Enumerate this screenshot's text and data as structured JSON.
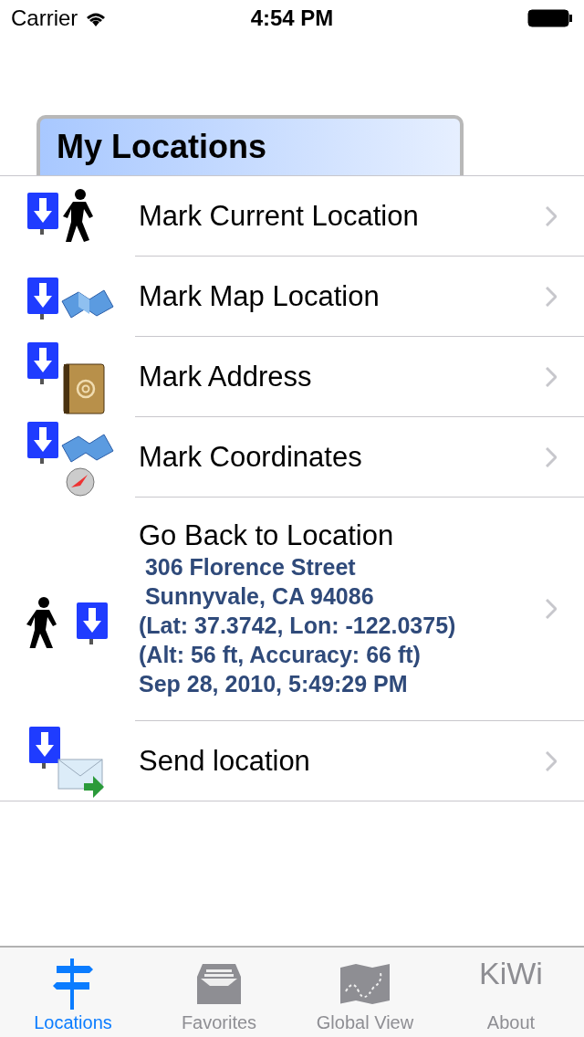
{
  "status_bar": {
    "carrier": "Carrier",
    "time": "4:54 PM"
  },
  "header": {
    "title": "My Locations"
  },
  "rows": [
    {
      "kind": "walk",
      "label": "Mark Current Location"
    },
    {
      "kind": "map",
      "label": "Mark Map Location"
    },
    {
      "kind": "address",
      "label": "Mark Address"
    },
    {
      "kind": "coords",
      "label": "Mark Coordinates"
    },
    {
      "kind": "return",
      "label": "Go Back to Location",
      "details": [
        " 306 Florence Street",
        " Sunnyvale, CA 94086",
        "(Lat: 37.3742, Lon: -122.0375)",
        "(Alt: 56 ft, Accuracy: 66 ft)",
        "Sep 28, 2010, 5:49:29 PM"
      ]
    },
    {
      "kind": "mail",
      "label": "Send location"
    }
  ],
  "tab_bar": [
    {
      "kind": "signpost",
      "label": "Locations",
      "selected": true
    },
    {
      "kind": "tray",
      "label": "Favorites",
      "selected": false
    },
    {
      "kind": "map",
      "label": "Global View",
      "selected": false
    },
    {
      "kind": "text",
      "icon_text": "KiWi",
      "label": "About",
      "selected": false
    }
  ]
}
